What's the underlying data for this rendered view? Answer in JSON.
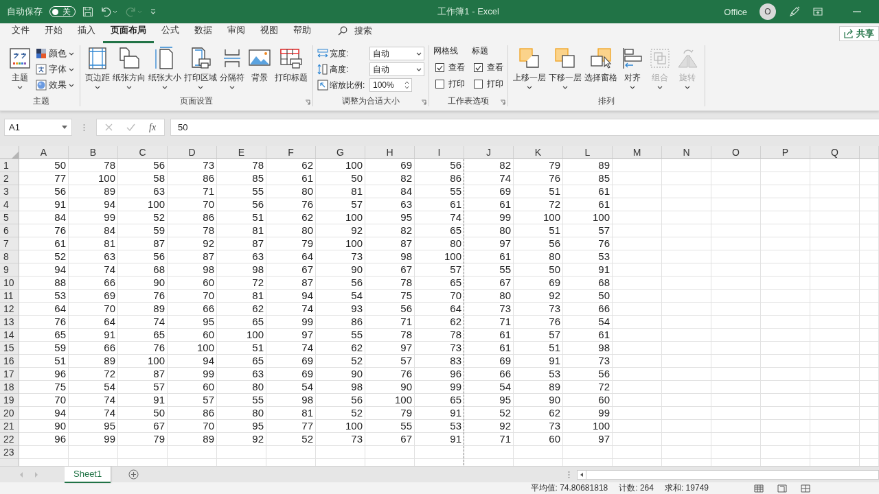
{
  "title_bar": {
    "autosave_label": "自动保存",
    "autosave": {
      "on": false,
      "label": "关"
    },
    "title": "工作簿1  -  Excel",
    "account": "Office",
    "avatar": "O"
  },
  "menu_tabs": [
    {
      "label": "文件",
      "selected": false
    },
    {
      "label": "开始",
      "selected": false
    },
    {
      "label": "插入",
      "selected": false
    },
    {
      "label": "页面布局",
      "selected": true
    },
    {
      "label": "公式",
      "selected": false
    },
    {
      "label": "数据",
      "selected": false
    },
    {
      "label": "审阅",
      "selected": false
    },
    {
      "label": "视图",
      "selected": false
    },
    {
      "label": "帮助",
      "selected": false
    }
  ],
  "search": "搜索",
  "share": "共享",
  "ribbon": {
    "groups": [
      {
        "label": "主题",
        "launcher": false,
        "items": [
          {
            "kind": "large",
            "label": "主题",
            "caret": true,
            "disabled": false
          },
          {
            "kind": "stack",
            "items": [
              {
                "label": "颜色",
                "caret": true
              },
              {
                "label": "字体",
                "caret": true
              },
              {
                "label": "效果",
                "caret": true
              }
            ]
          }
        ]
      },
      {
        "label": "页面设置",
        "launcher": true,
        "items": [
          {
            "kind": "large",
            "label": "页边距",
            "caret": true,
            "disabled": false
          },
          {
            "kind": "large",
            "label": "纸张方向",
            "caret": true,
            "disabled": false
          },
          {
            "kind": "large",
            "label": "纸张大小",
            "caret": true,
            "disabled": false
          },
          {
            "kind": "large",
            "label": "打印区域",
            "caret": true,
            "disabled": false
          },
          {
            "kind": "large",
            "label": "分隔符",
            "caret": true,
            "disabled": false
          },
          {
            "kind": "large",
            "label": "背景",
            "caret": false,
            "disabled": false
          },
          {
            "kind": "large",
            "label": "打印标题",
            "caret": false,
            "disabled": false
          }
        ]
      },
      {
        "label": "调整为合适大小",
        "launcher": true,
        "items": [
          {
            "kind": "fields",
            "items": [
              {
                "label": "宽度:",
                "value": "自动",
                "kind": "dropdown"
              },
              {
                "label": "高度:",
                "value": "自动",
                "kind": "dropdown"
              },
              {
                "label": "缩放比例:",
                "value": "100%",
                "kind": "spinner"
              }
            ]
          }
        ]
      },
      {
        "label": "工作表选项",
        "launcher": true,
        "items": [
          {
            "kind": "checks",
            "columns": [
              {
                "title": "网格线",
                "options": [
                  {
                    "label": "查看",
                    "checked": true
                  },
                  {
                    "label": "打印",
                    "checked": false
                  }
                ]
              },
              {
                "title": "标题",
                "options": [
                  {
                    "label": "查看",
                    "checked": true
                  },
                  {
                    "label": "打印",
                    "checked": false
                  }
                ]
              }
            ]
          }
        ]
      },
      {
        "label": "排列",
        "launcher": false,
        "items": [
          {
            "kind": "large",
            "label": "上移一层",
            "caret": true,
            "disabled": false
          },
          {
            "kind": "large",
            "label": "下移一层",
            "caret": true,
            "disabled": false
          },
          {
            "kind": "large",
            "label": "选择窗格",
            "caret": false,
            "disabled": false
          },
          {
            "kind": "large",
            "label": "对齐",
            "caret": true,
            "disabled": false
          },
          {
            "kind": "large",
            "label": "组合",
            "caret": true,
            "disabled": true
          },
          {
            "kind": "large",
            "label": "旋转",
            "caret": true,
            "disabled": true
          }
        ]
      }
    ]
  },
  "formula_bar": {
    "name_box": "A1",
    "function_label": "fx",
    "formula": "50"
  },
  "sheet": {
    "columns": [
      {
        "label": "A",
        "page_break": false
      },
      {
        "label": "B",
        "page_break": false
      },
      {
        "label": "C",
        "page_break": false
      },
      {
        "label": "D",
        "page_break": false
      },
      {
        "label": "E",
        "page_break": false
      },
      {
        "label": "F",
        "page_break": false
      },
      {
        "label": "G",
        "page_break": false
      },
      {
        "label": "H",
        "page_break": false
      },
      {
        "label": "I",
        "page_break": true
      },
      {
        "label": "J",
        "page_break": false
      },
      {
        "label": "K",
        "page_break": false
      },
      {
        "label": "L",
        "page_break": false
      },
      {
        "label": "M",
        "page_break": false
      },
      {
        "label": "N",
        "page_break": false
      },
      {
        "label": "O",
        "page_break": false
      },
      {
        "label": "P",
        "page_break": false
      },
      {
        "label": "Q",
        "page_break": false
      }
    ],
    "rows": [
      {
        "header": "1",
        "cells": [
          "50",
          "78",
          "56",
          "73",
          "78",
          "62",
          "100",
          "69",
          "56",
          "82",
          "79",
          "89"
        ]
      },
      {
        "header": "2",
        "cells": [
          "77",
          "100",
          "58",
          "86",
          "85",
          "61",
          "50",
          "82",
          "86",
          "74",
          "76",
          "85"
        ]
      },
      {
        "header": "3",
        "cells": [
          "56",
          "89",
          "63",
          "71",
          "55",
          "80",
          "81",
          "84",
          "55",
          "69",
          "51",
          "61"
        ]
      },
      {
        "header": "4",
        "cells": [
          "91",
          "94",
          "100",
          "70",
          "56",
          "76",
          "57",
          "63",
          "61",
          "61",
          "72",
          "61"
        ]
      },
      {
        "header": "5",
        "cells": [
          "84",
          "99",
          "52",
          "86",
          "51",
          "62",
          "100",
          "95",
          "74",
          "99",
          "100",
          "100"
        ]
      },
      {
        "header": "6",
        "cells": [
          "76",
          "84",
          "59",
          "78",
          "81",
          "80",
          "92",
          "82",
          "65",
          "80",
          "51",
          "57"
        ]
      },
      {
        "header": "7",
        "cells": [
          "61",
          "81",
          "87",
          "92",
          "87",
          "79",
          "100",
          "87",
          "80",
          "97",
          "56",
          "76"
        ]
      },
      {
        "header": "8",
        "cells": [
          "52",
          "63",
          "56",
          "87",
          "63",
          "64",
          "73",
          "98",
          "100",
          "61",
          "80",
          "53"
        ]
      },
      {
        "header": "9",
        "cells": [
          "94",
          "74",
          "68",
          "98",
          "98",
          "67",
          "90",
          "67",
          "57",
          "55",
          "50",
          "91"
        ]
      },
      {
        "header": "10",
        "cells": [
          "88",
          "66",
          "90",
          "60",
          "72",
          "87",
          "56",
          "78",
          "65",
          "67",
          "69",
          "68"
        ]
      },
      {
        "header": "11",
        "cells": [
          "53",
          "69",
          "76",
          "70",
          "81",
          "94",
          "54",
          "75",
          "70",
          "80",
          "92",
          "50"
        ]
      },
      {
        "header": "12",
        "cells": [
          "64",
          "70",
          "89",
          "66",
          "62",
          "74",
          "93",
          "56",
          "64",
          "73",
          "73",
          "66"
        ]
      },
      {
        "header": "13",
        "cells": [
          "76",
          "64",
          "74",
          "95",
          "65",
          "99",
          "86",
          "71",
          "62",
          "71",
          "76",
          "54"
        ]
      },
      {
        "header": "14",
        "cells": [
          "65",
          "91",
          "65",
          "60",
          "100",
          "97",
          "55",
          "78",
          "78",
          "61",
          "57",
          "61"
        ]
      },
      {
        "header": "15",
        "cells": [
          "59",
          "66",
          "76",
          "100",
          "51",
          "74",
          "62",
          "97",
          "73",
          "61",
          "51",
          "98"
        ]
      },
      {
        "header": "16",
        "cells": [
          "51",
          "89",
          "100",
          "94",
          "65",
          "69",
          "52",
          "57",
          "83",
          "69",
          "91",
          "73"
        ]
      },
      {
        "header": "17",
        "cells": [
          "96",
          "72",
          "87",
          "99",
          "63",
          "69",
          "90",
          "76",
          "96",
          "66",
          "53",
          "56"
        ]
      },
      {
        "header": "18",
        "cells": [
          "75",
          "54",
          "57",
          "60",
          "80",
          "54",
          "98",
          "90",
          "99",
          "54",
          "89",
          "72"
        ]
      },
      {
        "header": "19",
        "cells": [
          "70",
          "74",
          "91",
          "57",
          "55",
          "98",
          "56",
          "100",
          "65",
          "95",
          "90",
          "60"
        ]
      },
      {
        "header": "20",
        "cells": [
          "94",
          "74",
          "50",
          "86",
          "80",
          "81",
          "52",
          "79",
          "91",
          "52",
          "62",
          "99"
        ]
      },
      {
        "header": "21",
        "cells": [
          "90",
          "95",
          "67",
          "70",
          "95",
          "77",
          "100",
          "55",
          "53",
          "92",
          "73",
          "100"
        ]
      },
      {
        "header": "22",
        "cells": [
          "96",
          "99",
          "79",
          "89",
          "92",
          "52",
          "73",
          "67",
          "91",
          "71",
          "60",
          "97"
        ]
      },
      {
        "header": "23",
        "cells": []
      }
    ]
  },
  "sheet_tabs": [
    {
      "label": "Sheet1",
      "selected": true
    }
  ],
  "status_bar": [
    "平均值: 74.80681818",
    "计数: 264",
    "求和: 19749"
  ]
}
